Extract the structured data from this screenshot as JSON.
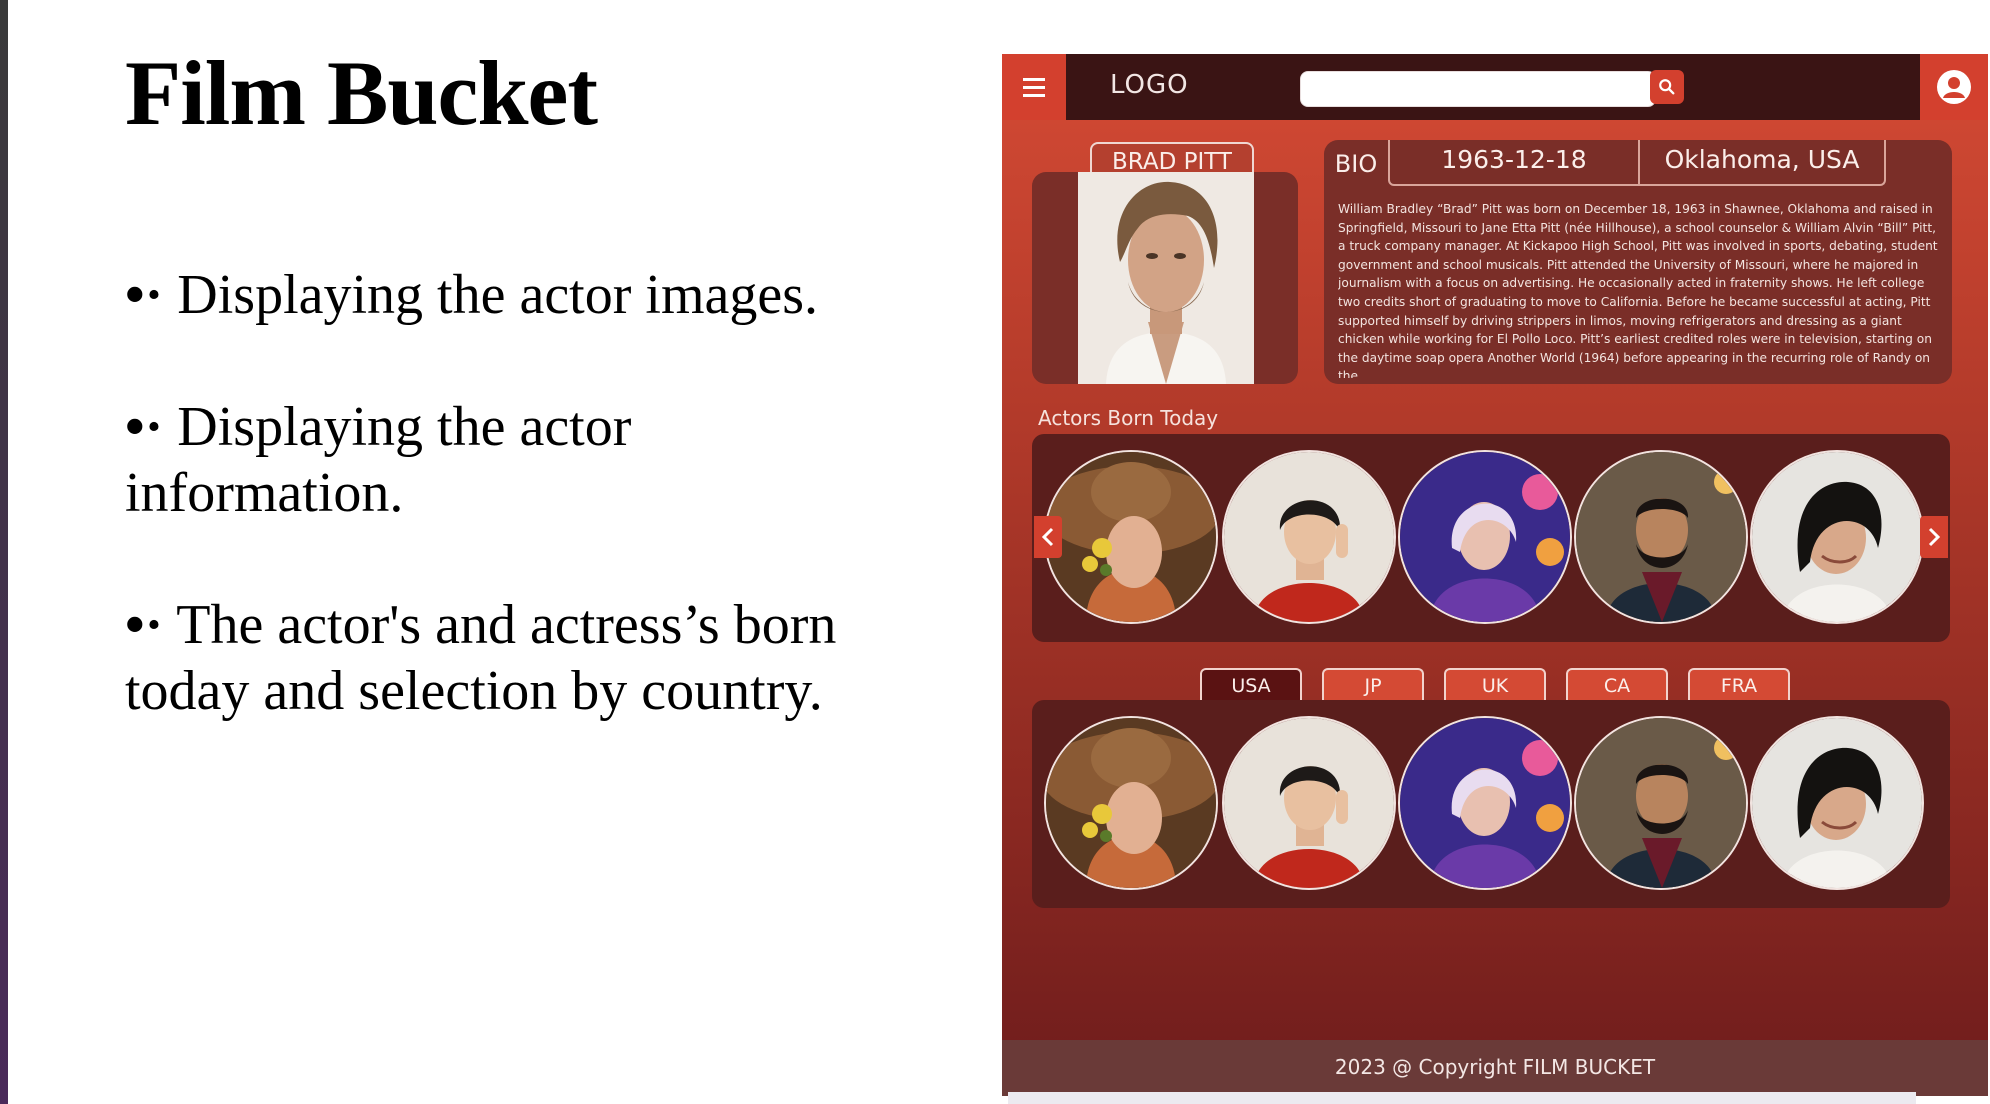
{
  "slide": {
    "title": "Film Bucket",
    "bullets": [
      "Displaying the actor images.",
      "Displaying the actor information.",
      "The actor's and actress’s born today and selection by country."
    ],
    "bullet_marker": "•·"
  },
  "app": {
    "header": {
      "logo": "LOGO",
      "search_placeholder": ""
    },
    "actor": {
      "name": "BRAD PITT",
      "bio_label": "BIO",
      "birth_date": "1963-12-18",
      "birth_place": "Oklahoma, USA",
      "bio": "William Bradley “Brad” Pitt was born on December 18, 1963 in Shawnee, Oklahoma and raised in Springfield, Missouri to Jane Etta Pitt (née Hillhouse), a school counselor & William Alvin “Bill” Pitt, a truck company manager.  At Kickapoo High School, Pitt was involved in sports, debating, student government and school musicals. Pitt attended the University of Missouri, where he majored in journalism with a focus on advertising. He occasionally acted in fraternity shows. He left college two credits short of graduating to move to California. Before he became successful at acting, Pitt supported himself by driving strippers in limos, moving refrigerators and dressing as a giant chicken while working for El Pollo Loco. Pitt’s earliest credited roles were in television, starting on the daytime soap opera Another World (1964) before appearing in the recurring role of Randy on the"
    },
    "born_today": {
      "label": "Actors Born Today"
    },
    "country_tabs": [
      "USA",
      "JP",
      "UK",
      "CA",
      "FRA"
    ],
    "active_tab": "USA",
    "footer": "2023 @ Copyright FILM BUCKET"
  },
  "colors": {
    "accent": "#d3402e",
    "header": "#3a1414",
    "card": "#7a2e28",
    "strip": "#5a1e1c",
    "footer": "#6a3a38"
  }
}
